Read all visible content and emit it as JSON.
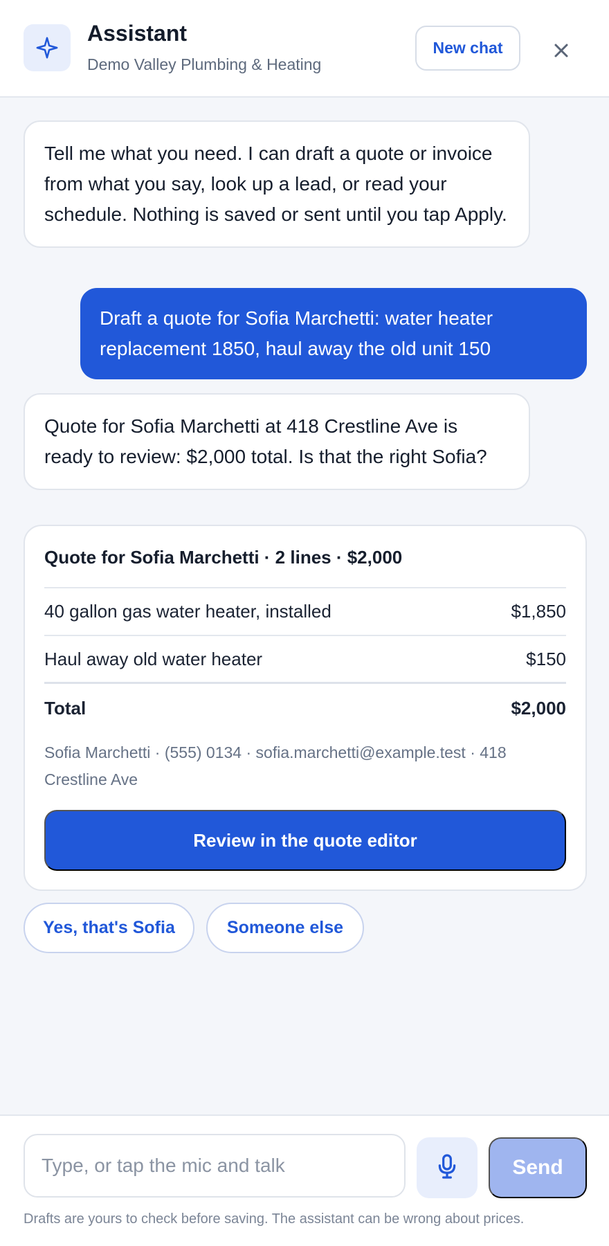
{
  "header": {
    "title": "Assistant",
    "subtitle": "Demo Valley Plumbing & Heating",
    "new_chat_label": "New chat",
    "icon": "sparkle-icon"
  },
  "messages": [
    {
      "role": "assistant",
      "text": "Tell me what you need. I can draft a quote or invoice from what you say, look up a lead, or read your schedule. Nothing is saved or sent until you tap Apply."
    },
    {
      "role": "user",
      "text": "Draft a quote for Sofia Marchetti: water heater replacement 1850, haul away the old unit 150"
    },
    {
      "role": "assistant",
      "text": "Quote for Sofia Marchetti at 418 Crestline Ave is ready to review: $2,000 total. Is that the right Sofia?"
    }
  ],
  "quote_card": {
    "title": "Quote for Sofia Marchetti · 2 lines · $2,000",
    "lines": [
      {
        "description": "40 gallon gas water heater, installed",
        "amount": "$1,850"
      },
      {
        "description": "Haul away old water heater",
        "amount": "$150"
      }
    ],
    "total_label": "Total",
    "total_amount": "$2,000",
    "contact": "Sofia Marchetti · (555) 0134 · sofia.marchetti@example.test · 418 Crestline Ave",
    "review_button": "Review in the quote editor"
  },
  "suggestions": [
    "Yes, that's Sofia",
    "Someone else"
  ],
  "composer": {
    "placeholder": "Type, or tap the mic and talk",
    "send_label": "Send",
    "disclaimer": "Drafts are yours to check before saving. The assistant can be wrong about prices."
  },
  "colors": {
    "accent": "#2158d9",
    "accent_soft": "#e8eefc",
    "send_disabled": "#9fb5ef",
    "background": "#f4f6fa"
  }
}
